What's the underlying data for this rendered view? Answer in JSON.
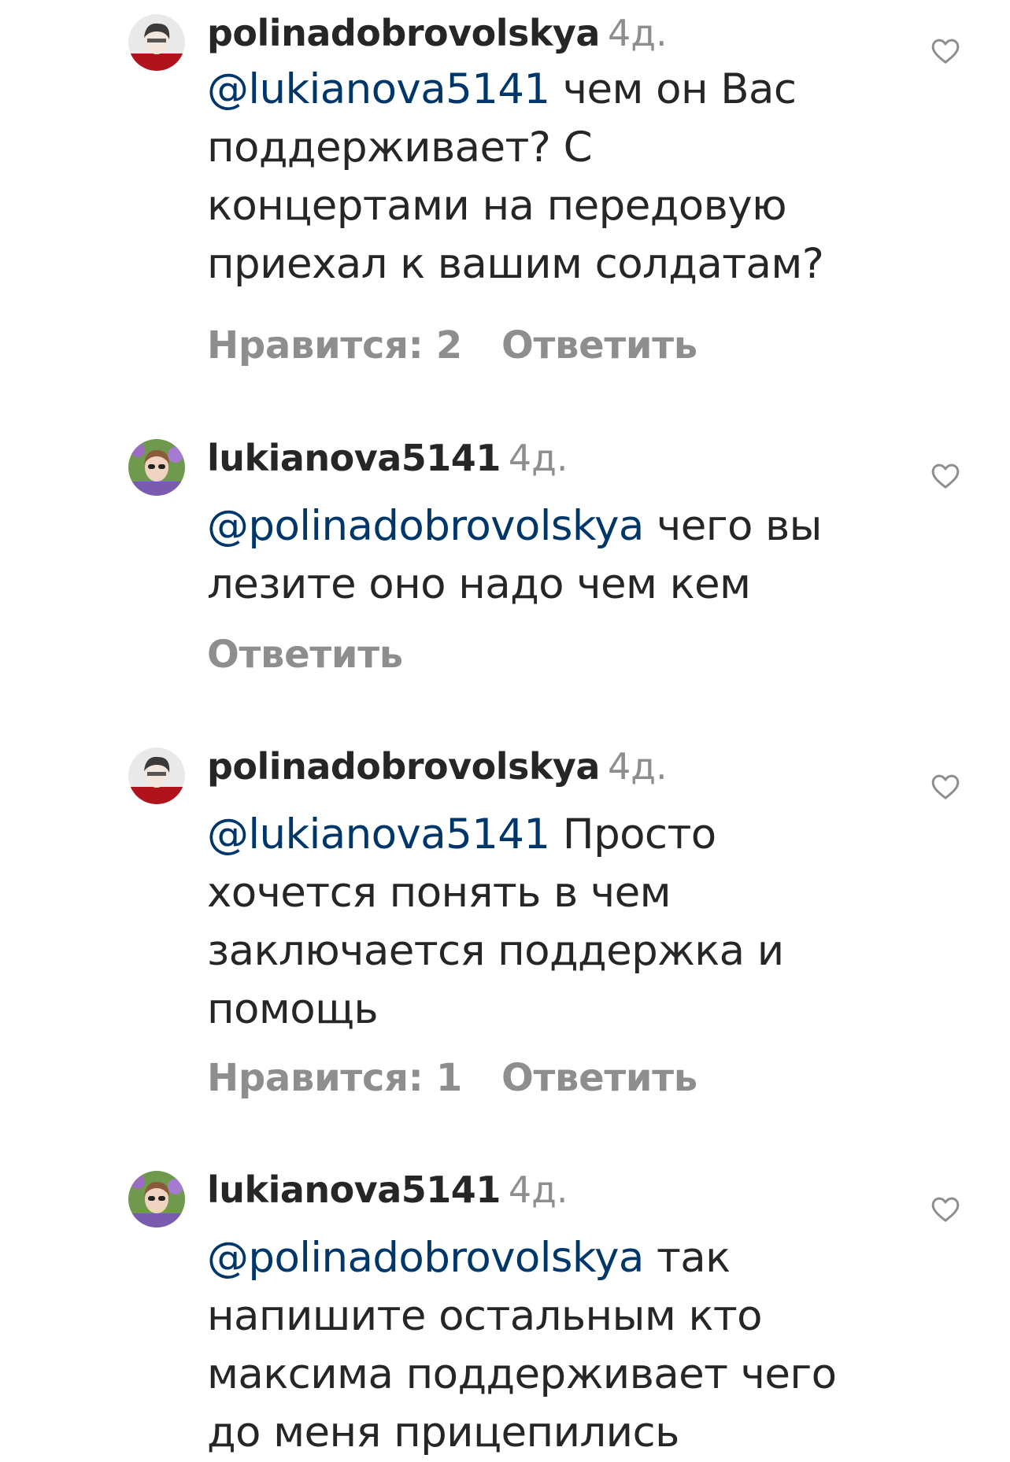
{
  "colors": {
    "text": "#262626",
    "muted": "#8e8e8e",
    "mention": "#00376b"
  },
  "comments": [
    {
      "username": "polinadobrovolskya",
      "time": "4д.",
      "mention": "@lukianova5141",
      "lines": [
        " чем он Вас",
        "поддерживает? С",
        "концертами на передовую",
        "приехал к вашим солдатам?"
      ],
      "likes": "Нравится: 2",
      "reply": "Ответить",
      "avatar_icon": "user-avatar",
      "like_icon": "heart-outline-icon"
    },
    {
      "username": "lukianova5141",
      "time": "4д.",
      "mention": "@polinadobrovolskya",
      "lines": [
        " чего вы",
        "лезите оно надо чем кем"
      ],
      "likes": "",
      "reply": "Ответить",
      "avatar_icon": "user-avatar",
      "like_icon": "heart-outline-icon"
    },
    {
      "username": "polinadobrovolskya",
      "time": "4д.",
      "mention": "@lukianova5141",
      "lines": [
        " Просто",
        "хочется понять в чем",
        "заключается поддержка и",
        "помощь"
      ],
      "likes": "Нравится: 1",
      "reply": "Ответить",
      "avatar_icon": "user-avatar",
      "like_icon": "heart-outline-icon"
    },
    {
      "username": "lukianova5141",
      "time": "4д.",
      "mention": "@polinadobrovolskya",
      "lines": [
        " так",
        "напишите остальным кто",
        "максима поддерживает чего",
        "до меня прицепились"
      ],
      "likes": "",
      "reply": "",
      "avatar_icon": "user-avatar",
      "like_icon": "heart-outline-icon"
    }
  ]
}
